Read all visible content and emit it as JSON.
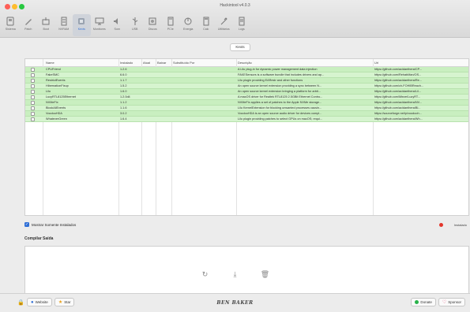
{
  "window": {
    "title": "Hackintool v4.0.3"
  },
  "toolbar": [
    {
      "label": "Sistema",
      "icon": "system-icon"
    },
    {
      "label": "Patch",
      "icon": "patch-icon"
    },
    {
      "label": "Boot",
      "icon": "boot-icon"
    },
    {
      "label": "NVRAM",
      "icon": "nvram-icon"
    },
    {
      "label": "Kexts",
      "icon": "kexts-icon",
      "active": true
    },
    {
      "label": "Monitores",
      "icon": "display-icon"
    },
    {
      "label": "Som",
      "icon": "sound-icon"
    },
    {
      "label": "USB",
      "icon": "usb-icon"
    },
    {
      "label": "Discos",
      "icon": "disk-icon"
    },
    {
      "label": "PCIe",
      "icon": "pcie-icon"
    },
    {
      "label": "Energia",
      "icon": "power-icon"
    },
    {
      "label": "Calc",
      "icon": "calc-icon"
    },
    {
      "label": "Utilitários",
      "icon": "tools-icon"
    },
    {
      "label": "Logs",
      "icon": "logs-icon"
    }
  ],
  "segment": {
    "label": "Kexts"
  },
  "table": {
    "headers": [
      "Name",
      "Instalado",
      "Atual",
      "Baixar",
      "Substituído Por",
      "Descrição",
      "Url"
    ],
    "rows": [
      {
        "name": "CPUFriend",
        "installed": "1.2.6",
        "desc": "A Lilu plug-in for dynamic power management data injection",
        "url": "https://github.com/acidanthera/CP..."
      },
      {
        "name": "FakeSMC",
        "installed": "6.6.0",
        "desc": "FAKESensors is a software bundle that includes drivers and ap...",
        "url": "https://github.com/RehabMan/OS..."
      },
      {
        "name": "RestrictEvents",
        "installed": "1.1.7",
        "desc": "Lilu plugin providing EARestr and other functions",
        "url": "https://github.com/acidanthera/Re..."
      },
      {
        "name": "HibernationFixup",
        "installed": "1.5.2",
        "desc": "An open source kernel extension providing a sync between N...",
        "url": "https://github.com/ch-FOHIBReach..."
      },
      {
        "name": "Lilu",
        "installed": "1.6.0",
        "desc": "An open source kernel extension bringing a platform for arbit...",
        "url": "https://github.com/acidanthera/Lil..."
      },
      {
        "name": "LucyRTL8125Ethernet",
        "installed": "1.2.0d4",
        "desc": "A macOS driver for Realtek RTL8125 2.5GBit Ethernet Contro...",
        "url": "https://github.com/Mieze/LucyRT..."
      },
      {
        "name": "NVMeFix",
        "installed": "1.1.2",
        "desc": "NVMeFix applies a set of patches to the Apple NVMe storage...",
        "url": "https://github.com/acidanthera/NV..."
      },
      {
        "name": "BlockAllEvents",
        "installed": "1.1.6",
        "desc": "Lilu KernelExtension for blocking unwanted processes causin...",
        "url": "https://github.com/acidanthera/Bl..."
      },
      {
        "name": "VoodooHDA",
        "installed": "3.0.2",
        "desc": "VoodooHDA is an open source audio driver for devices compl...",
        "url": "https://sourceforge.net/p/voodooh..."
      },
      {
        "name": "WhateverGreen",
        "installed": "1.6.4",
        "desc": "Lilu plugin providing patches to select GPUs on macOS; requi...",
        "url": "https://github.com/acidanthera/Wh..."
      }
    ]
  },
  "show_installed": {
    "label": "Mostrar Somente Instalados",
    "checked": true
  },
  "legend": {
    "label": "Instalado",
    "color": "#e3352b"
  },
  "compile": {
    "title": "Compilar Saída"
  },
  "actions": [
    {
      "icon": "refresh-icon",
      "glyph": "↻"
    },
    {
      "icon": "download-icon",
      "glyph": "⤓"
    },
    {
      "icon": "trash-icon",
      "glyph": "🗑"
    }
  ],
  "bottom": {
    "website_label": "Website",
    "star_label": "Star",
    "brand": "BEN BAKER",
    "donate_label": "Donate",
    "sponsor_label": "Sponsor"
  }
}
